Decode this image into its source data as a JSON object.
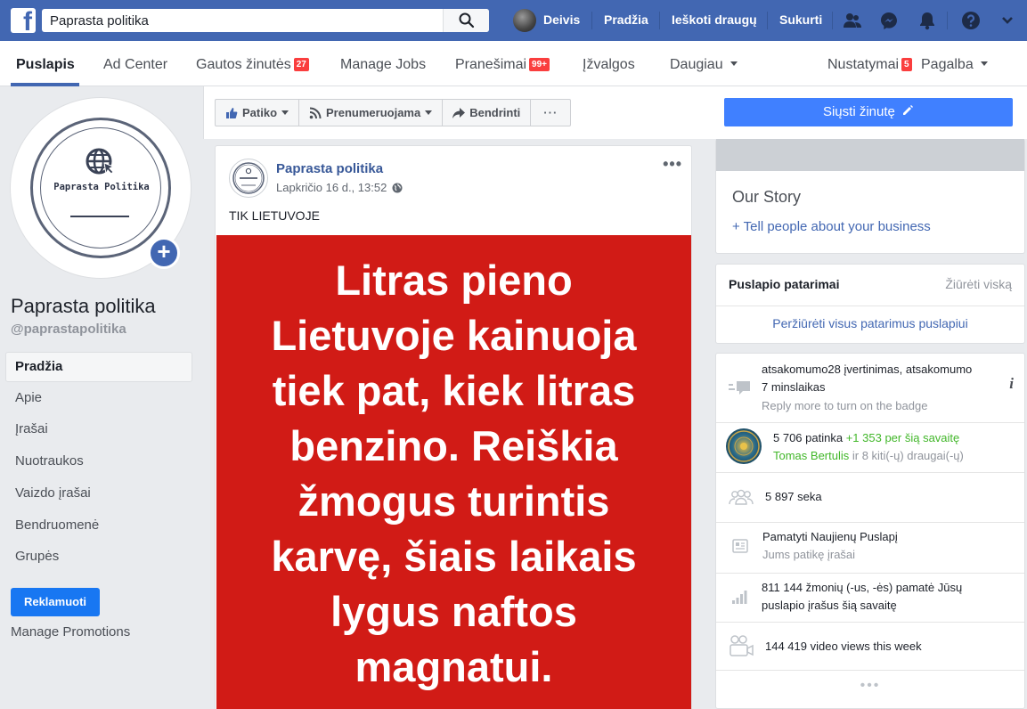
{
  "topbar": {
    "search_value": "Paprasta politika",
    "user_name": "Deivis",
    "links": [
      "Pradžia",
      "Ieškoti draugų",
      "Sukurti"
    ]
  },
  "subnav": {
    "tabs": [
      {
        "label": "Puslapis"
      },
      {
        "label": "Ad Center"
      },
      {
        "label": "Gautos žinutės",
        "badge": "27"
      },
      {
        "label": "Manage Jobs"
      },
      {
        "label": "Pranešimai",
        "badge": "99+"
      },
      {
        "label": "Įžvalgos"
      },
      {
        "label": "Daugiau"
      }
    ],
    "settings_label": "Nustatymai",
    "settings_badge": "5",
    "help_label": "Pagalba"
  },
  "profile": {
    "logo_text": "Paprasta Politika",
    "name": "Paprasta politika",
    "handle": "@paprastapolitika"
  },
  "left_nav": [
    "Pradžia",
    "Apie",
    "Įrašai",
    "Nuotraukos",
    "Vaizdo įrašai",
    "Bendruomenė",
    "Grupės"
  ],
  "promote_label": "Reklamuoti",
  "manage_promotions": "Manage Promotions",
  "actions": {
    "like": "Patiko",
    "follow": "Prenumeruojama",
    "share": "Bendrinti",
    "more": "···",
    "send_message": "Siųsti žinutę"
  },
  "post": {
    "author": "Paprasta politika",
    "timestamp": "Lapkričio 16 d., 13:52",
    "text": "TIK LIETUVOJE",
    "image_lines": [
      "Litras pieno",
      "Lietuvoje kainuoja",
      "tiek pat, kiek litras",
      "benzino. Reiškia",
      "žmogus turintis",
      "karvę, šiais laikais",
      "lygus naftos",
      "magnatui."
    ]
  },
  "story": {
    "title": "Our Story",
    "link": "+ Tell people about your business"
  },
  "tips": {
    "title": "Puslapio patarimai",
    "see_all": "Žiūrėti viską",
    "review": "Peržiūrėti visus patarimus puslapiui"
  },
  "stats": {
    "response_1": "atsakomumo28 įvertinimas, atsakomumo",
    "response_2": "7 minslaikas",
    "response_hint": "Reply more to turn on the badge",
    "likes": "5 706 patinka",
    "likes_week": "+1 353 per šią savaitę",
    "friend_name": "Tomas Bertulis",
    "friend_rest": "ir 8 kiti(-ų) draugai(-ų)",
    "follows": "5 897 seka",
    "news_1": "Pamatyti Naujienų Puslapį",
    "news_2": "Jums patikę įrašai",
    "reach_1": "811 144 žmonių (-us, -ės) pamatė Jūsų",
    "reach_2": "puslapio įrašus šią savaitę",
    "video": "144 419 video views this week"
  }
}
